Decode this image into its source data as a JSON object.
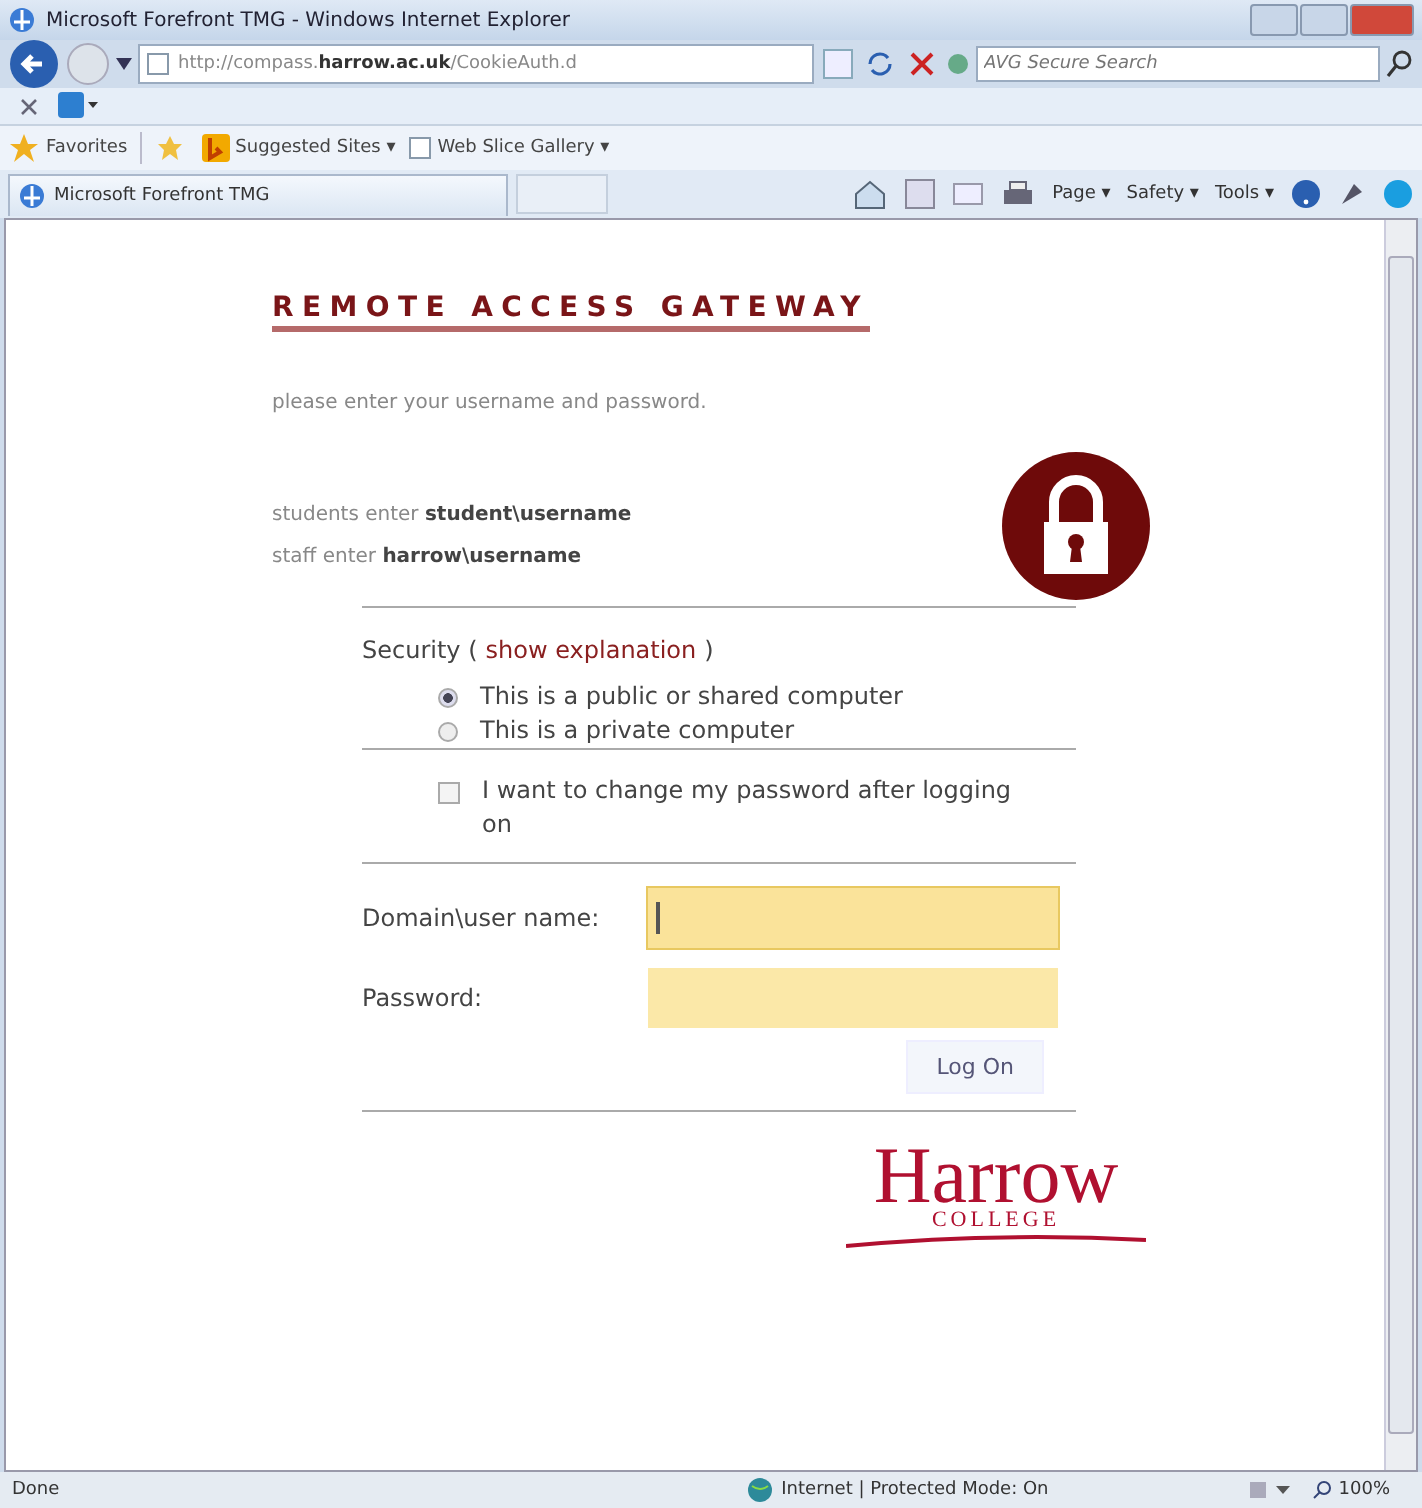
{
  "window": {
    "title": "Microsoft Forefront TMG - Windows Internet Explorer"
  },
  "address_bar": {
    "url": "http://compass.**harrow.ac.uk**/CookieAuth.d"
  },
  "search": {
    "placeholder": "AVG Secure Search"
  },
  "favorites_bar": {
    "favorites": "Favorites",
    "links": [
      "Suggested Sites ▾",
      "Web Slice Gallery ▾"
    ]
  },
  "tab": {
    "title": "Microsoft Forefront TMG"
  },
  "command_bar": {
    "menus": [
      "Page ▾",
      "Safety ▾",
      "Tools ▾"
    ]
  },
  "page": {
    "heading": "REMOTE ACCESS GATEWAY",
    "intro": "please enter your username and password.",
    "hints": [
      "students enter **student\\username**",
      "staff enter **harrow\\username**"
    ],
    "security": {
      "label": "Security (",
      "link": "show explanation",
      "close": ")",
      "options": [
        {
          "label": "This is a public or shared computer",
          "selected": true
        },
        {
          "label": "This is a private computer",
          "selected": false
        }
      ]
    },
    "change_password": {
      "label": "I want to change my password after logging on",
      "checked": false
    },
    "fields": [
      {
        "label": "Domain\\user name:",
        "focused": true
      },
      {
        "label": "Password:",
        "focused": false
      }
    ],
    "submit": "Log On",
    "logo": {
      "name": "Harrow",
      "sub": "COLLEGE"
    }
  },
  "status_bar": {
    "status": "Done",
    "zone": "Internet | Protected Mode: On",
    "zoom": "100%"
  }
}
